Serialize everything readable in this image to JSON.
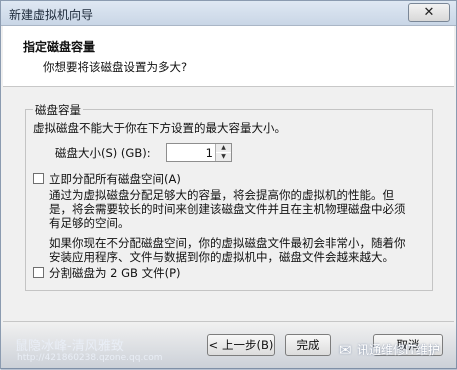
{
  "window": {
    "title": "新建虚拟机向导"
  },
  "header": {
    "title": "指定磁盘容量",
    "subtitle": "你想要将该磁盘设置为多大?"
  },
  "disk": {
    "group_label": "磁盘容量",
    "max_note": "虚拟磁盘不能大于你在下方设置的最大容量大小。",
    "size_label": "磁盘大小(S) (GB):",
    "size_value": "1",
    "allocate": {
      "label": "立即分配所有磁盘空间(A)",
      "checked": false,
      "desc_lines": [
        "通过为虚拟磁盘分配足够大的容量，将会提高你的虚拟机的性能。但",
        "是，将会需要较长的时间来创建该磁盘文件并且在主机物理磁盘中必须",
        "有足够的空间。"
      ]
    },
    "no_allocate_lines": [
      "如果你现在不分配磁盘空间，你的虚拟磁盘文件最初会非常小，随着你",
      "安装应用程序、文件与数据到你的虚拟机中，磁盘文件会越来越大。"
    ],
    "split": {
      "label": "分割磁盘为 2 GB 文件(P)",
      "checked": false
    }
  },
  "buttons": {
    "back": "< 上一步(B)",
    "finish": "完成",
    "cancel": "取消"
  },
  "watermarks": {
    "left_title": "鼠隐冰峰-清风雅致",
    "left_url": "http://421860238.qzone.qq.com",
    "right": "讯通维修IT维护"
  }
}
